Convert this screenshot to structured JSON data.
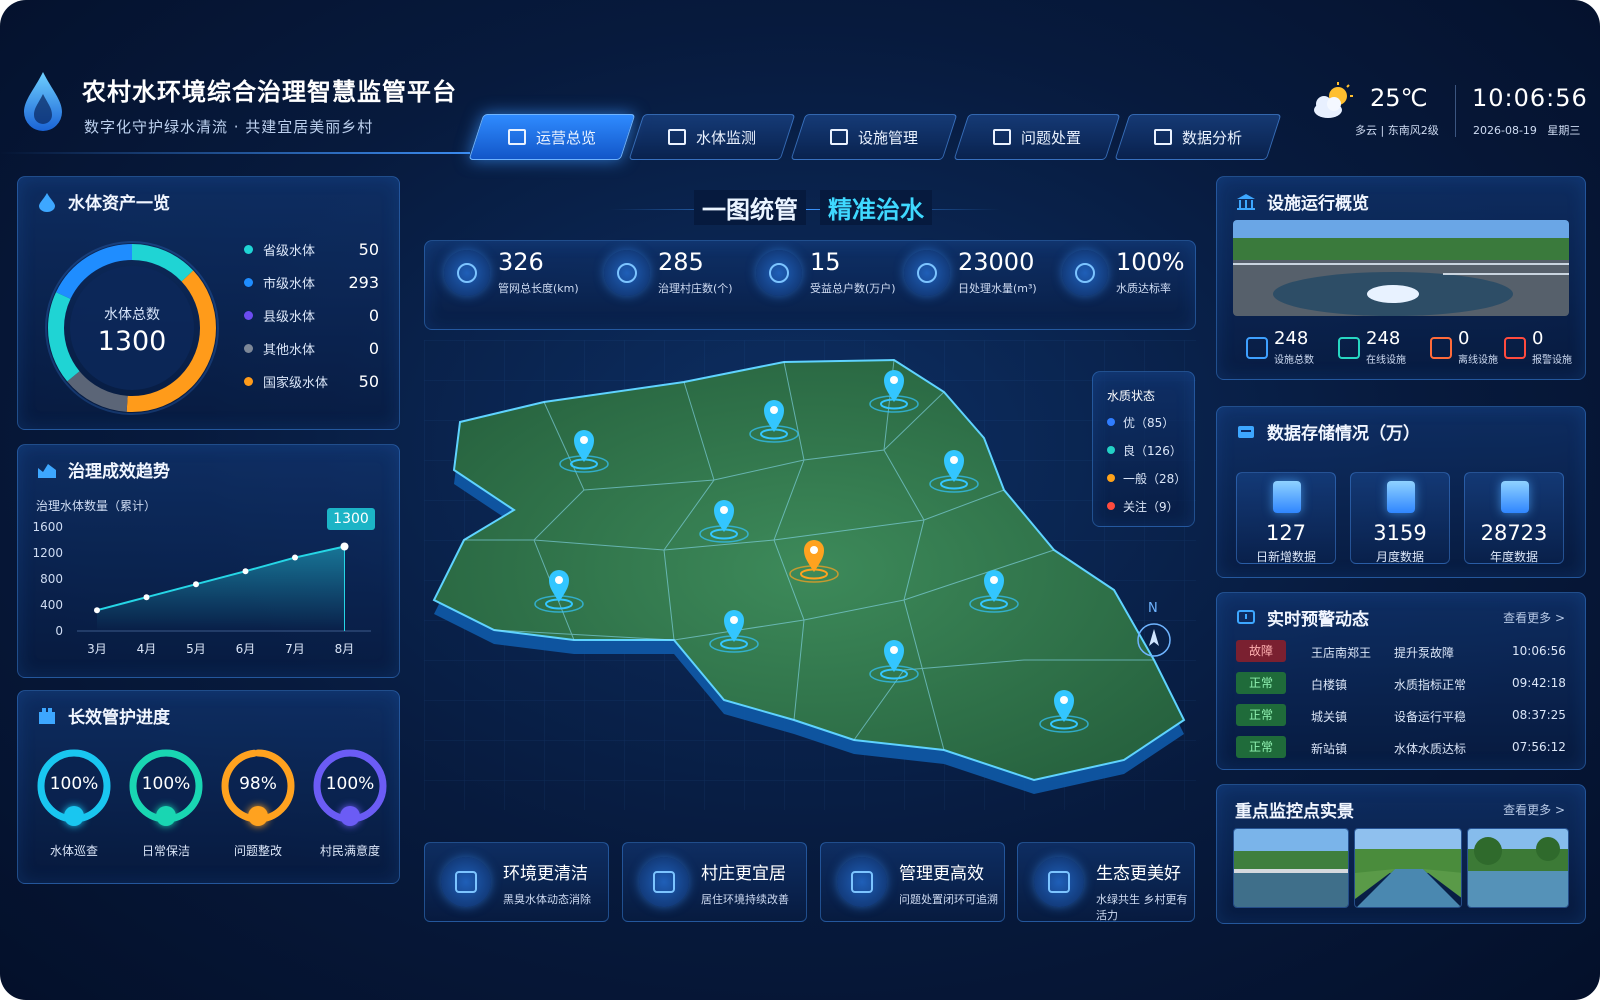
{
  "header": {
    "title": "农村水环境综合治理智慧监管平台",
    "subtitle": "数字化守护绿水清流 · 共建宜居美丽乡村",
    "nav": [
      {
        "label": "运营总览",
        "icon": "home-icon",
        "active": true
      },
      {
        "label": "水体监测",
        "icon": "water-monitor-icon",
        "active": false
      },
      {
        "label": "设施管理",
        "icon": "facility-icon",
        "active": false
      },
      {
        "label": "问题处置",
        "icon": "document-icon",
        "active": false
      },
      {
        "label": "数据分析",
        "icon": "bar-chart-icon",
        "active": false
      }
    ],
    "weather": {
      "temp": "25℃",
      "desc": "多云 | 东南风2级",
      "icon": "partly-cloudy-icon"
    },
    "time": "10:06:56",
    "date": "2026-08-19   星期三"
  },
  "assets": {
    "title": "水体资产一览",
    "center_label": "水体总数",
    "center_value": "1300",
    "items": [
      {
        "label": "省级水体",
        "value": "50",
        "color": "#1fd4d4"
      },
      {
        "label": "市级水体",
        "value": "293",
        "color": "#1f8dff"
      },
      {
        "label": "县级水体",
        "value": "0",
        "color": "#6b4cf0"
      },
      {
        "label": "其他水体",
        "value": "0",
        "color": "#7d8797"
      },
      {
        "label": "国家级水体",
        "value": "50",
        "color": "#ff9b1a"
      }
    ]
  },
  "trend": {
    "title": "治理成效趋势",
    "subtitle": "治理水体数量（累计）",
    "callout": "1300"
  },
  "chart_data": {
    "type": "line",
    "categories": [
      "3月",
      "4月",
      "5月",
      "6月",
      "7月",
      "8月"
    ],
    "values": [
      320,
      520,
      720,
      920,
      1130,
      1300
    ],
    "ylim": [
      0,
      1600
    ],
    "yticks": [
      0,
      400,
      800,
      1200,
      1600
    ],
    "series_color": "#26d6e6",
    "area_fill": true,
    "grid": false
  },
  "progress": {
    "title": "长效管护进度",
    "items": [
      {
        "label": "水体巡查",
        "pct": "100%",
        "value": 100,
        "color": "#19c6f0",
        "icon": "inspection-icon"
      },
      {
        "label": "日常保洁",
        "pct": "100%",
        "value": 100,
        "color": "#19d6b2",
        "icon": "cleaning-icon"
      },
      {
        "label": "问题整改",
        "pct": "98%",
        "value": 98,
        "color": "#ffa21f",
        "icon": "wrench-icon"
      },
      {
        "label": "村民满意度",
        "pct": "100%",
        "value": 100,
        "color": "#6b5cf5",
        "icon": "people-icon"
      }
    ]
  },
  "center": {
    "title_left": "一图统管",
    "title_right": "精准治水",
    "kpis": [
      {
        "value": "326",
        "label": "管网总长度(km)",
        "icon": "pipe-icon"
      },
      {
        "value": "285",
        "label": "治理村庄数(个)",
        "icon": "village-icon"
      },
      {
        "value": "15",
        "label": "受益总户数(万户)",
        "icon": "household-icon"
      },
      {
        "value": "23000",
        "label": "日处理水量(m³)",
        "icon": "water-drop-icon"
      },
      {
        "value": "100%",
        "label": "水质达标率",
        "icon": "quality-icon"
      }
    ],
    "legend": {
      "title": "水质状态",
      "items": [
        {
          "label": "优（85）",
          "color": "#2f7dff"
        },
        {
          "label": "良（126）",
          "color": "#23d1c5"
        },
        {
          "label": "一般（28）",
          "color": "#ffa31a"
        },
        {
          "label": "关注（9）",
          "color": "#ff4b3e"
        }
      ]
    },
    "compass": "N",
    "cards": [
      {
        "title": "环境更清洁",
        "sub": "黑臭水体动态消除",
        "icon": "leaf-icon"
      },
      {
        "title": "村庄更宜居",
        "sub": "居住环境持续改善",
        "icon": "house-icon"
      },
      {
        "title": "管理更高效",
        "sub": "问题处置闭环可追溯",
        "icon": "shield-star-icon"
      },
      {
        "title": "生态更美好",
        "sub": "水绿共生 乡村更有活力",
        "icon": "water-drop-icon"
      }
    ]
  },
  "facility": {
    "title": "设施运行概览",
    "stats": [
      {
        "value": "248",
        "label": "设施总数",
        "icon": "building-icon",
        "color": "#3ea0ff"
      },
      {
        "value": "248",
        "label": "在线设施",
        "icon": "chart-up-icon",
        "color": "#27d6c2"
      },
      {
        "value": "0",
        "label": "离线设施",
        "icon": "gear-icon",
        "color": "#ff6b3a"
      },
      {
        "value": "0",
        "label": "报警设施",
        "icon": "alarm-icon",
        "color": "#ff4b3e"
      }
    ]
  },
  "storage": {
    "title": "数据存储情况（万）",
    "items": [
      {
        "value": "127",
        "label": "日新增数据",
        "icon": "file-icon"
      },
      {
        "value": "3159",
        "label": "月度数据",
        "icon": "database-icon"
      },
      {
        "value": "28723",
        "label": "年度数据",
        "icon": "cloud-upload-icon"
      }
    ]
  },
  "alerts": {
    "title": "实时预警动态",
    "more": "查看更多 >",
    "rows": [
      {
        "status": "故障",
        "town": "王店南郑王",
        "event": "提升泵故障",
        "time": "10:06:56",
        "type": "fault"
      },
      {
        "status": "正常",
        "town": "白楼镇",
        "event": "水质指标正常",
        "time": "09:42:18",
        "type": "ok"
      },
      {
        "status": "正常",
        "town": "城关镇",
        "event": "设备运行平稳",
        "time": "08:37:25",
        "type": "ok"
      },
      {
        "status": "正常",
        "town": "新站镇",
        "event": "水体水质达标",
        "time": "07:56:12",
        "type": "ok"
      }
    ]
  },
  "scenes": {
    "title": "重点监控点实景",
    "more": "查看更多 >"
  }
}
